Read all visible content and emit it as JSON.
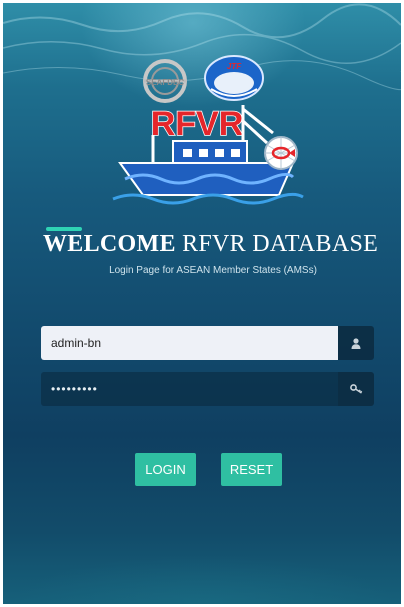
{
  "logo": {
    "seafdec_text": "SEAFDEC",
    "jtf_text": "JTF",
    "brand_text": "RFVR"
  },
  "header": {
    "title_bold": "WELCOME",
    "title_rest": " RFVR DATABASE",
    "subtitle": "Login Page for ASEAN Member States (AMSs)"
  },
  "form": {
    "username_value": "admin-bn",
    "username_icon": "user-icon",
    "password_value": "•••••••••",
    "password_icon": "key-icon"
  },
  "buttons": {
    "login_label": "LOGIN",
    "reset_label": "RESET"
  },
  "colors": {
    "accent": "#2fd3b4",
    "button": "#2fbfa2",
    "brand_red": "#e5262b",
    "ocean_dark": "#0f3f61"
  }
}
